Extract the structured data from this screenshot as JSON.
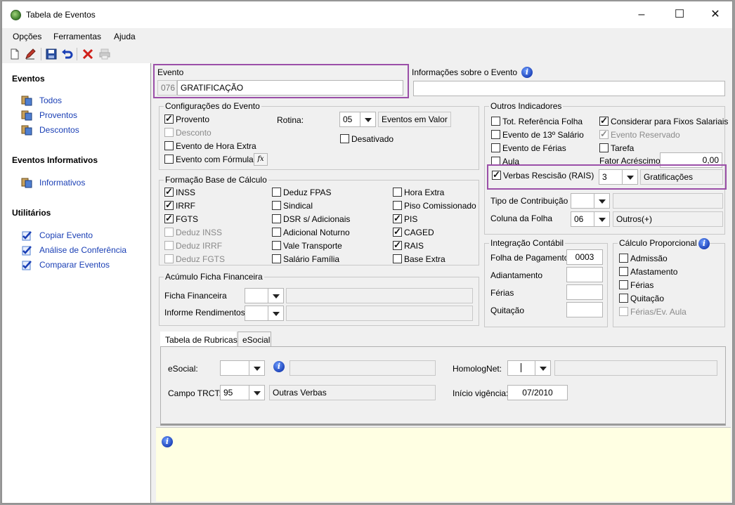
{
  "window": {
    "title": "Tabela de Eventos"
  },
  "menu": [
    "Opções",
    "Ferramentas",
    "Ajuda"
  ],
  "sidebar": {
    "sections": [
      {
        "title": "Eventos",
        "items": [
          "Todos",
          "Proventos",
          "Descontos"
        ]
      },
      {
        "title": "Eventos Informativos",
        "items": [
          "Informativos"
        ]
      },
      {
        "title": "Utilitários",
        "items": [
          "Copiar Evento",
          "Análise de Conferência",
          "Comparar Eventos"
        ]
      }
    ]
  },
  "evento": {
    "label": "Evento",
    "code": "076",
    "name": "GRATIFICAÇÃO"
  },
  "info_evento": {
    "label": "Informações sobre o Evento",
    "value": ""
  },
  "config": {
    "legend": "Configurações do Evento",
    "provento": "Provento",
    "desconto": "Desconto",
    "hora_extra": "Evento de Hora Extra",
    "formula": "Evento com Fórmula",
    "fx": "fx",
    "rotina_label": "Rotina:",
    "rotina_value": "05",
    "rotina_desc": "Eventos em Valor",
    "desativado": "Desativado"
  },
  "outros": {
    "legend": "Outros Indicadores",
    "tot_ref": "Tot. Referência Folha",
    "ev13": "Evento de 13º Salário",
    "ferias": "Evento de Férias",
    "aula": "Aula",
    "considerar": "Considerar para Fixos Salariais",
    "reservado": "Evento Reservado",
    "tarefa": "Tarefa",
    "fator_label": "Fator Acréscimo",
    "fator_value": "0,00",
    "verbas_label": "Verbas Rescisão (RAIS)",
    "verbas_value": "3",
    "verbas_desc": "Gratificações",
    "tipo_label": "Tipo de Contribuição",
    "coluna_label": "Coluna da Folha",
    "coluna_value": "06",
    "coluna_desc": "Outros(+)"
  },
  "base": {
    "legend": "Formação Base de Cálculo",
    "col1": [
      "INSS",
      "IRRF",
      "FGTS",
      "Deduz INSS",
      "Deduz IRRF",
      "Deduz FGTS"
    ],
    "col2": [
      "Deduz FPAS",
      "Sindical",
      "DSR s/ Adicionais",
      "Adicional Noturno",
      "Vale Transporte",
      "Salário Família"
    ],
    "col3": [
      "Hora Extra",
      "Piso Comissionado",
      "PIS",
      "CAGED",
      "RAIS",
      "Base Extra"
    ]
  },
  "acumulo": {
    "legend": "Acúmulo Ficha Financeira",
    "ficha": "Ficha Financeira",
    "informe": "Informe Rendimentos"
  },
  "integracao": {
    "legend": "Integração Contábil",
    "folha": "Folha de Pagamento",
    "folha_value": "0003",
    "adiantamento": "Adiantamento",
    "ferias": "Férias",
    "quitacao": "Quitação"
  },
  "proporcional": {
    "legend": "Cálculo Proporcional",
    "items": [
      "Admissão",
      "Afastamento",
      "Férias",
      "Quitação",
      "Férias/Ev. Aula"
    ]
  },
  "tabs": [
    "Tabela de Rubricas",
    "eSocial"
  ],
  "rubricas": {
    "esocial_label": "eSocial:",
    "homolog_label": "HomologNet:",
    "campo_label": "Campo TRCT:",
    "campo_value": "95",
    "campo_desc": "Outras Verbas",
    "inicio_label": "Início vigência:",
    "inicio_value": "07/2010"
  },
  "colors": {
    "highlight": "#9b4fa8",
    "link": "#1a3fb5",
    "note_bg": "#ffffe3"
  }
}
